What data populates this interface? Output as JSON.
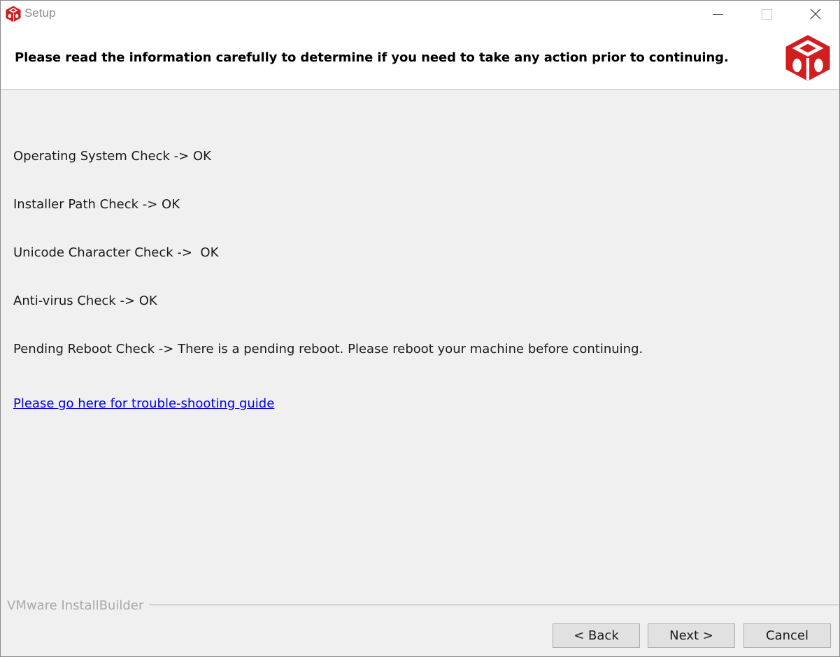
{
  "window": {
    "title": "Setup",
    "controls": {
      "minimize_icon": "minimize-icon",
      "maximize_icon": "maximize-icon",
      "close_icon": "close-icon"
    }
  },
  "header": {
    "instruction": "Please read the information carefully to determine if you need to take any action prior to continuing.",
    "logo_icon": "red-cube-logo-icon",
    "accent_color": "#d21d21"
  },
  "checks": [
    {
      "text": "Operating System Check -> OK"
    },
    {
      "text": "Installer Path Check -> OK"
    },
    {
      "text": "Unicode Character Check ->  OK"
    },
    {
      "text": "Anti-virus Check -> OK"
    },
    {
      "text": "Pending Reboot Check -> There is a pending reboot. Please reboot your machine before continuing."
    }
  ],
  "link": {
    "text": "Please go here for trouble-shooting guide",
    "color": "#0000ee"
  },
  "footer": {
    "brand": "VMware InstallBuilder",
    "buttons": {
      "back": "< Back",
      "next": "Next >",
      "cancel": "Cancel"
    }
  }
}
